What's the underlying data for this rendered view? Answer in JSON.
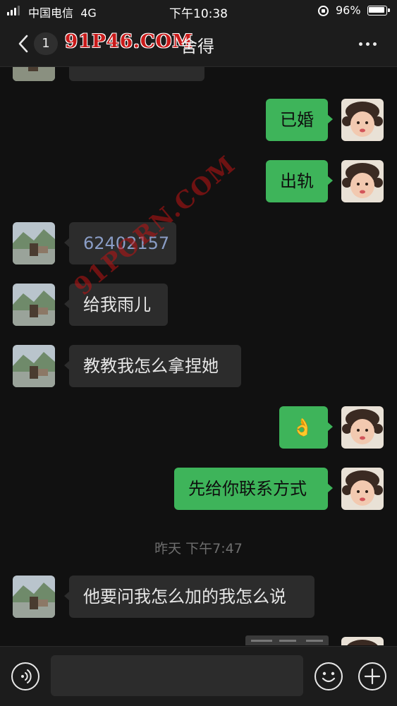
{
  "status_bar": {
    "carrier": "中国电信",
    "network": "4G",
    "time": "下午10:38",
    "battery": "96%"
  },
  "header": {
    "unread_count": "1",
    "watermark": "91P46.COM",
    "title": "舍得"
  },
  "watermark_diagonal": "91PORN.COM",
  "messages": [
    {
      "side": "in",
      "text": ""
    },
    {
      "side": "out",
      "text": "已婚"
    },
    {
      "side": "out",
      "text": "出轨"
    },
    {
      "side": "in",
      "text": "62402157"
    },
    {
      "side": "in",
      "text": "给我雨儿"
    },
    {
      "side": "in",
      "text": "教教我怎么拿捏她"
    },
    {
      "side": "out",
      "text": "👌"
    },
    {
      "side": "out",
      "text": "先给你联系方式"
    },
    {
      "side": "in",
      "text": "他要问我怎么加的我怎么说"
    },
    {
      "side": "out",
      "text": "",
      "type": "image"
    }
  ],
  "timestamp": "昨天 下午7:47",
  "input_bar": {
    "placeholder": ""
  },
  "colors": {
    "background": "#111111",
    "outgoing_bubble": "#3eb45a",
    "incoming_bubble": "#2c2c2c",
    "watermark": "#c81a1a"
  },
  "icons": {
    "back": "chevron-left-icon",
    "more": "ellipsis-icon",
    "voice": "voice-icon",
    "emoji": "emoji-icon",
    "plus": "plus-icon"
  }
}
